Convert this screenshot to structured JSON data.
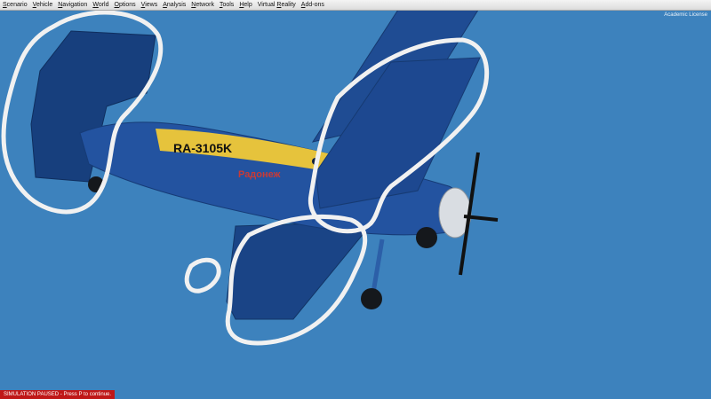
{
  "menu": {
    "items": [
      {
        "id": "scenario",
        "label": "Scenario",
        "u": "S"
      },
      {
        "id": "vehicle",
        "label": "Vehicle",
        "u": "V"
      },
      {
        "id": "navigation",
        "label": "Navigation",
        "u": "N"
      },
      {
        "id": "world",
        "label": "World",
        "u": "W"
      },
      {
        "id": "options",
        "label": "Options",
        "u": "O"
      },
      {
        "id": "views",
        "label": "Views",
        "u": "V"
      },
      {
        "id": "analysis",
        "label": "Analysis",
        "u": "A"
      },
      {
        "id": "network",
        "label": "Network",
        "u": "N"
      },
      {
        "id": "tools",
        "label": "Tools",
        "u": "T"
      },
      {
        "id": "help",
        "label": "Help",
        "u": "H"
      },
      {
        "id": "virtual-reality",
        "label": "Virtual Reality",
        "u": "R"
      },
      {
        "id": "add-ons",
        "label": "Add-ons",
        "u": "A"
      }
    ]
  },
  "license_text": "Academic License",
  "status": {
    "paused_text": "SIMULATION PAUSED - Press P to continue."
  },
  "aircraft": {
    "registration": "RA-3105K",
    "name": "Радонеж"
  },
  "colors": {
    "sky": "#3d82bd",
    "fuselage": "#1f4e9a",
    "yellow_stripe": "#e8c43a",
    "annotation": "#f1f1f1",
    "status_bg": "#c01818"
  }
}
